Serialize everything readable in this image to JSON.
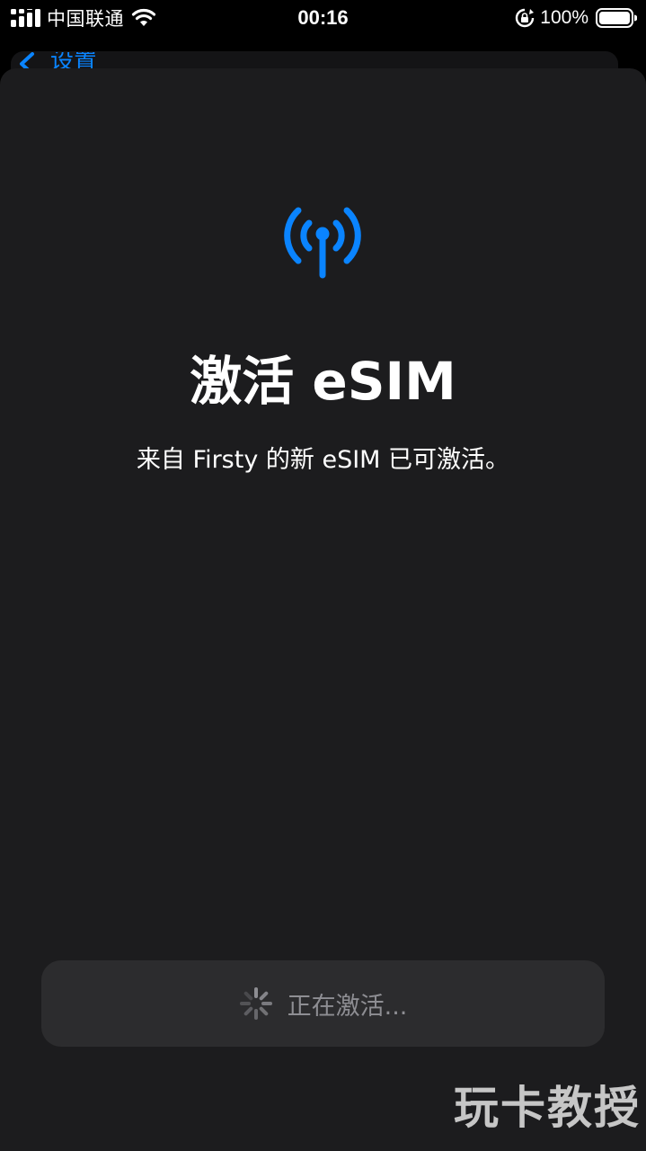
{
  "status_bar": {
    "carrier": "中国联通",
    "time": "00:16",
    "battery": "100%",
    "icons": [
      "signal-icon",
      "wifi-icon",
      "rotation-lock-icon",
      "battery-icon"
    ]
  },
  "back_nav": {
    "label": "设置",
    "icon": "chevron-left-icon"
  },
  "sheet": {
    "icon": "antenna-icon",
    "title": "激活 eSIM",
    "subtitle": "来自 Firsty 的新 eSIM 已可激活。"
  },
  "activate_button": {
    "label": "正在激活...",
    "icon": "spinner-icon"
  },
  "watermark": "玩卡教授",
  "colors": {
    "accent": "#0a84ff",
    "sheet_bg": "#1c1c1e",
    "button_bg": "#2c2c2e",
    "secondary_text": "#8e8e93"
  }
}
